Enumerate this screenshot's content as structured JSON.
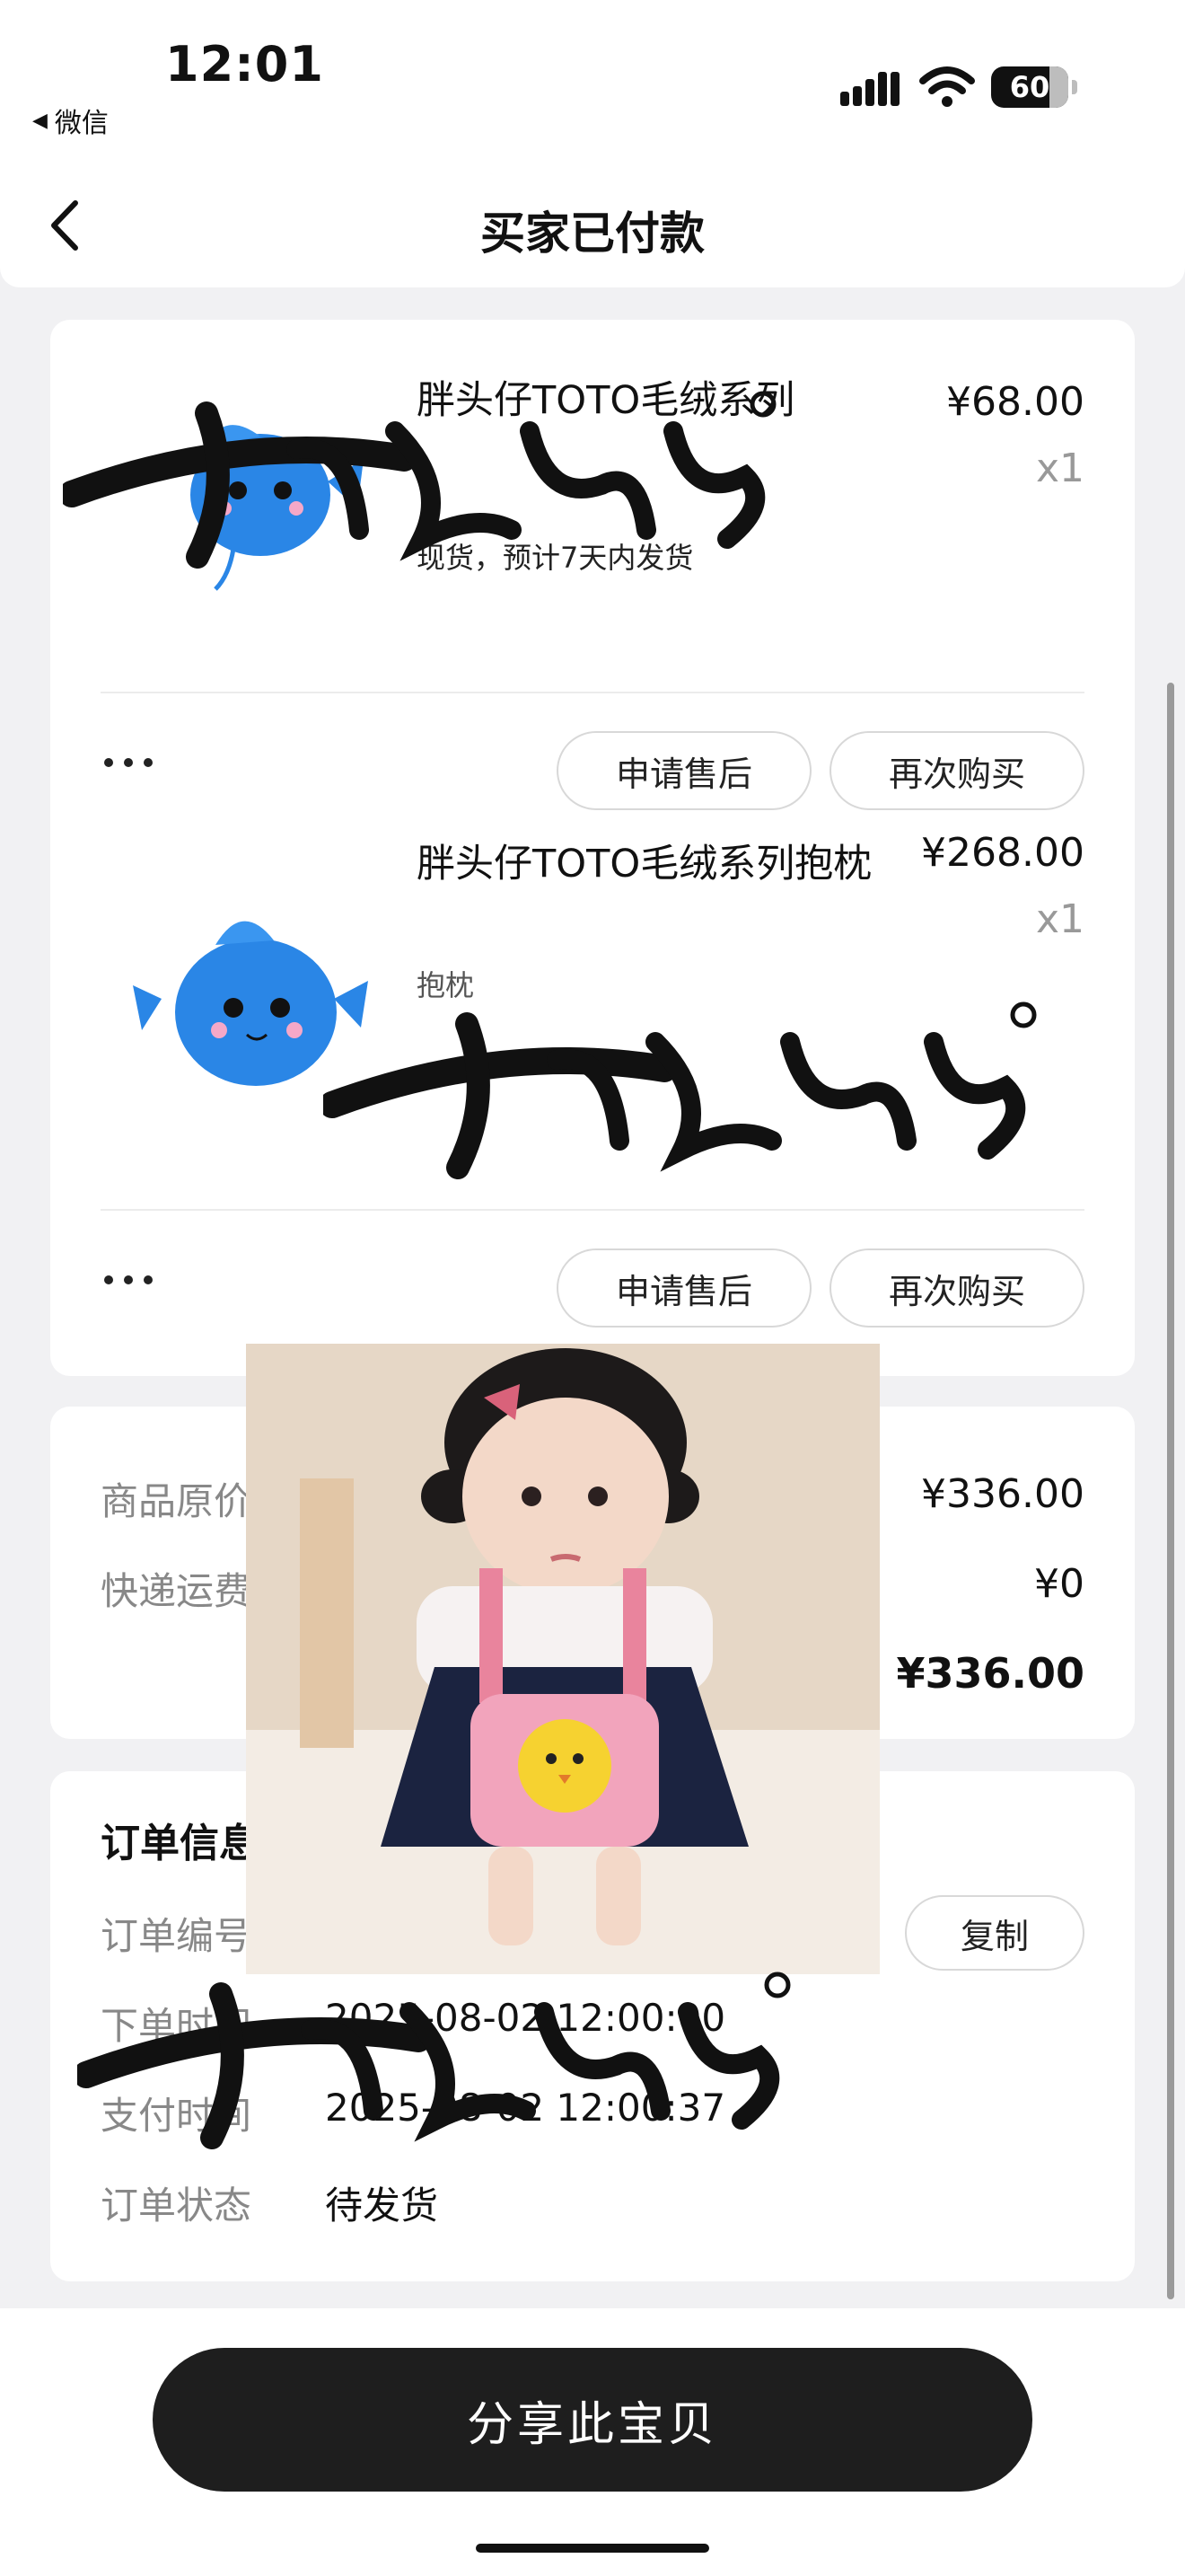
{
  "status_bar": {
    "time": "12:01",
    "back_app": "微信",
    "back_arrow": "◀",
    "battery": "60",
    "icons": [
      "signal-icon",
      "wifi-icon",
      "battery-icon"
    ]
  },
  "nav": {
    "title": "买家已付款",
    "back_icon": "chevron-left-icon"
  },
  "products": [
    {
      "name": "胖头仔TOTO毛绒系列",
      "spec": "",
      "shipping_note": "现货，预计7天内发货",
      "price": "¥68.00",
      "qty": "x1",
      "more_icon": "more-dots-icon",
      "after_sale_label": "申请售后",
      "buy_again_label": "再次购买"
    },
    {
      "name": "胖头仔TOTO毛绒系列抱枕",
      "spec": "抱枕",
      "shipping_note": "",
      "price": "¥268.00",
      "qty": "x1",
      "more_icon": "more-dots-icon",
      "after_sale_label": "申请售后",
      "buy_again_label": "再次购买"
    }
  ],
  "summary": {
    "original_price_label": "商品原价",
    "original_price": "¥336.00",
    "shipping_label": "快递运费",
    "shipping": "¥0",
    "total": "¥336.00"
  },
  "order_info": {
    "title": "订单信息",
    "order_no_label": "订单编号",
    "copy_label": "复制",
    "created_label": "下单时间",
    "created_value": "2025-08-02 12:00:00",
    "paid_label": "支付时间",
    "paid_value": "2025-08-02 12:00:37",
    "status_label": "订单状态",
    "status_value": "待发货"
  },
  "bottom": {
    "share_label": "分享此宝贝"
  },
  "watermark_icon": "calligraphy-watermark-icon",
  "colors": {
    "background": "#f1f1f3",
    "card": "#ffffff",
    "primary_button": "#1e1e1e",
    "muted_text": "#888888",
    "toy_blue": "#2a86e6"
  }
}
